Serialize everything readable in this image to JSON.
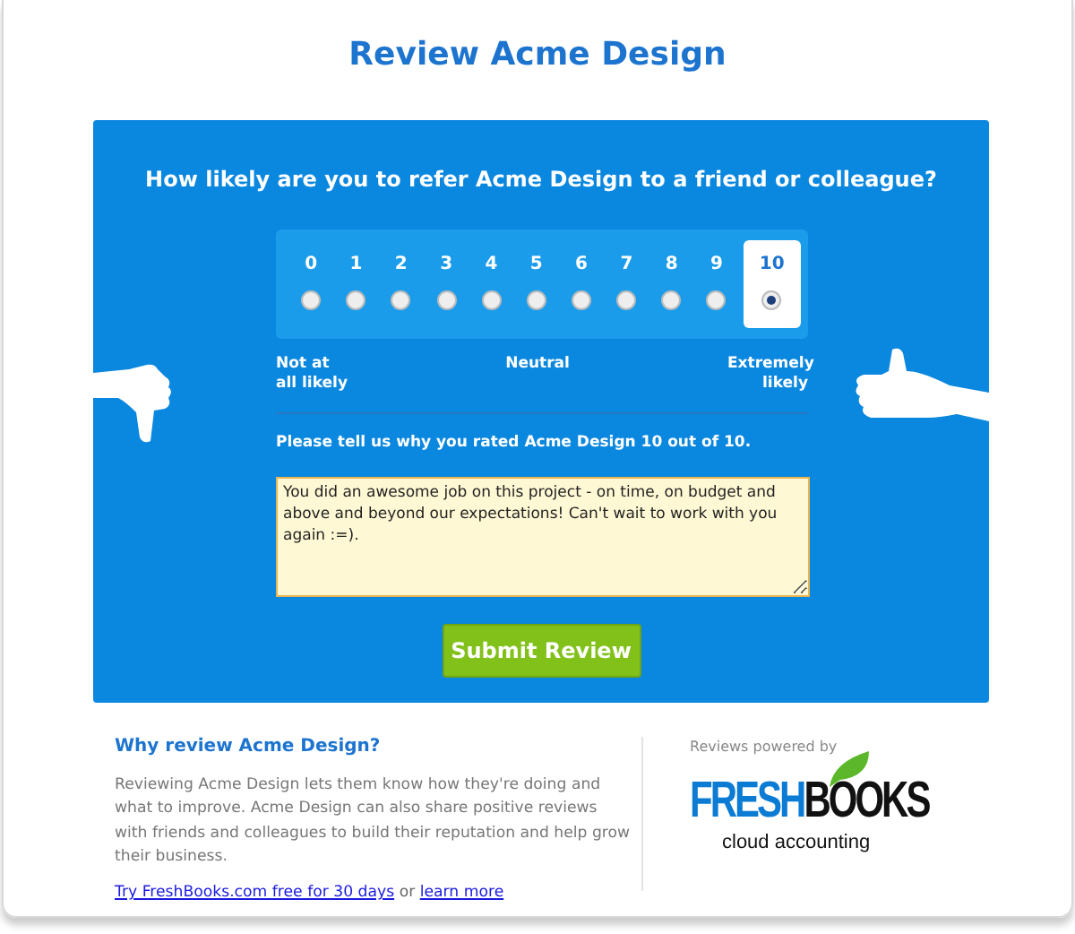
{
  "title": "Review Acme Design",
  "question": "How likely are you to refer Acme Design to a friend or colleague?",
  "scale": {
    "options": [
      {
        "label": "0",
        "selected": false
      },
      {
        "label": "1",
        "selected": false
      },
      {
        "label": "2",
        "selected": false
      },
      {
        "label": "3",
        "selected": false
      },
      {
        "label": "4",
        "selected": false
      },
      {
        "label": "5",
        "selected": false
      },
      {
        "label": "6",
        "selected": false
      },
      {
        "label": "7",
        "selected": false
      },
      {
        "label": "8",
        "selected": false
      },
      {
        "label": "9",
        "selected": false
      },
      {
        "label": "10",
        "selected": true
      }
    ],
    "low_label": "Not at all likely",
    "mid_label": "Neutral",
    "high_label": "Extremely likely"
  },
  "prompt": "Please tell us why you rated Acme Design 10 out of 10.",
  "comment": {
    "value": "You did an awesome job on this project - on time, on budget and above and beyond our expectations! Can't wait to work with you again :=)."
  },
  "submit_button": "Submit Review",
  "info": {
    "heading": "Why review Acme Design?",
    "body": "Reviewing Acme Design lets them know how they're doing and what to improve. Acme Design can also share positive reviews with friends and colleagues to build their reputation and help grow their business.",
    "trial_link": "Try FreshBooks.com free for 30 days",
    "joiner": "or",
    "learn_link": "learn more"
  },
  "powered": {
    "caption": "Reviews powered by",
    "logo_first": "FRESH",
    "logo_second": "BOOKS",
    "tagline": "cloud accounting"
  }
}
